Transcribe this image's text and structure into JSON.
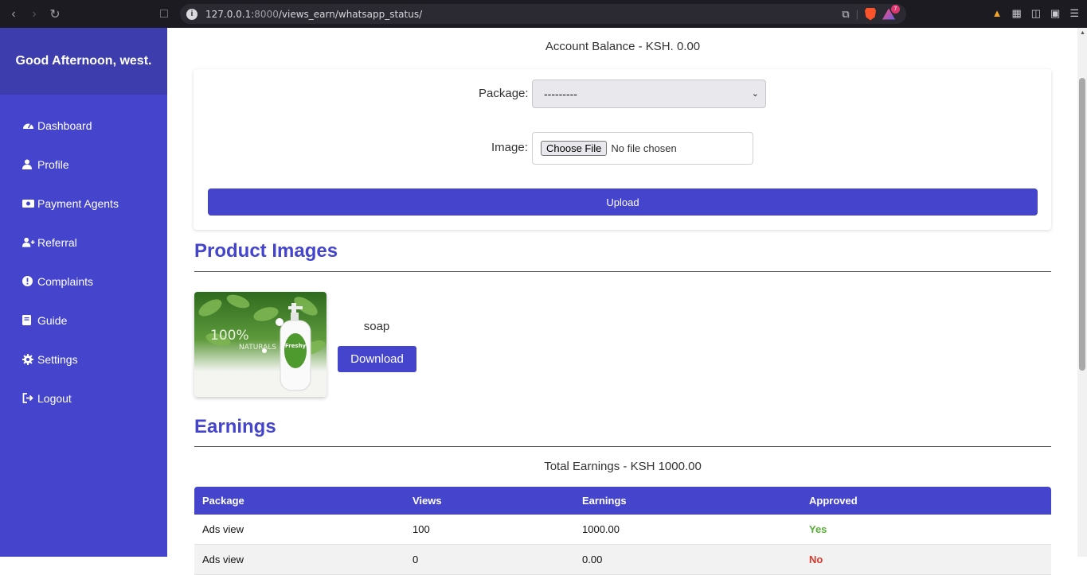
{
  "browser": {
    "url_host": "127.0.0.1:",
    "url_port": "8000",
    "url_path": "/views_earn/whatsapp_status/",
    "rewards_badge": "7"
  },
  "sidebar": {
    "greeting": "Good Afternoon, west.",
    "items": [
      {
        "label": "Dashboard",
        "icon": "gauge-icon"
      },
      {
        "label": "Profile",
        "icon": "user-icon"
      },
      {
        "label": "Payment Agents",
        "icon": "money-icon"
      },
      {
        "label": "Referral",
        "icon": "user-plus-icon"
      },
      {
        "label": "Complaints",
        "icon": "exclamation-icon"
      },
      {
        "label": "Guide",
        "icon": "book-icon"
      },
      {
        "label": "Settings",
        "icon": "gear-icon"
      },
      {
        "label": "Logout",
        "icon": "logout-icon"
      }
    ]
  },
  "main": {
    "balance": "Account Balance - KSH. 0.00",
    "form": {
      "package_label": "Package:",
      "package_value": "---------",
      "image_label": "Image:",
      "file_button": "Choose File",
      "file_text": "No file chosen",
      "upload_label": "Upload"
    },
    "product_images": {
      "title": "Product Images",
      "image_text_top": "100%",
      "image_text_bottom": "NATURALS",
      "bottle_brand": "Freshy",
      "name": "soap",
      "download_label": "Download"
    },
    "earnings": {
      "title": "Earnings",
      "total": "Total Earnings - KSH 1000.00",
      "columns": [
        "Package",
        "Views",
        "Earnings",
        "Approved"
      ],
      "rows": [
        {
          "package": "Ads view",
          "views": "100",
          "earnings": "1000.00",
          "approved": "Yes"
        },
        {
          "package": "Ads view",
          "views": "0",
          "earnings": "0.00",
          "approved": "No"
        }
      ]
    }
  },
  "colors": {
    "accent": "#4444cc",
    "approved_yes": "#5aae3a",
    "approved_no": "#d83a2e"
  }
}
